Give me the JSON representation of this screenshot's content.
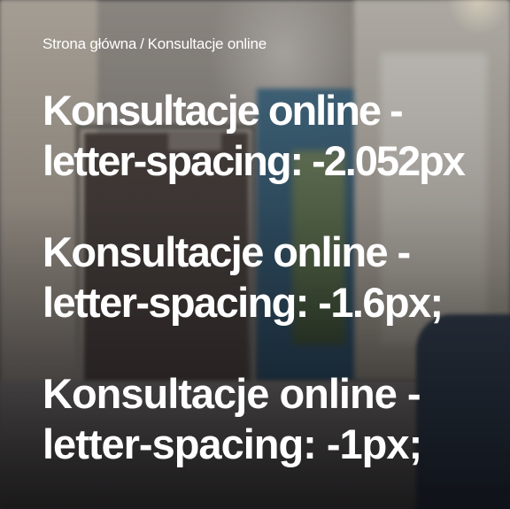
{
  "breadcrumb": {
    "home": "Strona główna",
    "separator": "/",
    "current": "Konsultacje online"
  },
  "headings": [
    {
      "line1": "Konsultacje online -",
      "line2": "letter-spacing: -2.052px"
    },
    {
      "line1": "Konsultacje online -",
      "line2": "letter-spacing: -1.6px;"
    },
    {
      "line1": "Konsultacje online -",
      "line2": "letter-spacing: -1px;"
    }
  ],
  "colors": {
    "text": "#ffffff"
  }
}
